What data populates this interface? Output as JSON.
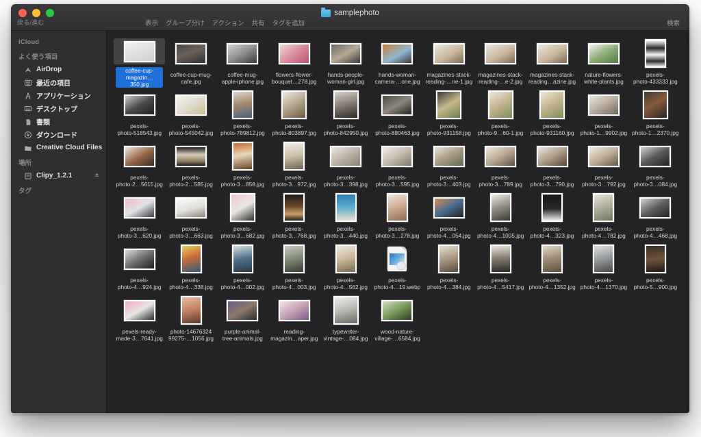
{
  "window": {
    "title": "samplephoto",
    "nav_label": "戻る/進む",
    "folder_icon": "folder-icon",
    "traffic": {
      "close": "close-button",
      "minimize": "minimize-button",
      "maximize": "maximize-button"
    }
  },
  "toolbar": {
    "items": [
      {
        "label": "表示",
        "name": "view"
      },
      {
        "label": "グループ分け",
        "name": "group-by"
      },
      {
        "label": "アクション",
        "name": "action"
      },
      {
        "label": "共有",
        "name": "share"
      },
      {
        "label": "タグを追加",
        "name": "add-tag"
      }
    ],
    "search_label": "検索"
  },
  "sidebar": {
    "sections": [
      {
        "header": "iCloud",
        "items": []
      },
      {
        "header": "よく使う項目",
        "items": [
          {
            "label": "AirDrop",
            "icon": "airdrop-icon"
          },
          {
            "label": "最近の項目",
            "icon": "recents-icon"
          },
          {
            "label": "アプリケーション",
            "icon": "applications-icon"
          },
          {
            "label": "デスクトップ",
            "icon": "desktop-icon"
          },
          {
            "label": "書類",
            "icon": "documents-icon"
          },
          {
            "label": "ダウンロード",
            "icon": "downloads-icon"
          },
          {
            "label": "Creative Cloud Files",
            "icon": "folder-icon"
          }
        ]
      },
      {
        "header": "場所",
        "items": [
          {
            "label": "Clipy_1.2.1",
            "icon": "disk-icon",
            "eject": true
          }
        ]
      },
      {
        "header": "タグ",
        "items": []
      }
    ]
  },
  "colors": {
    "selection_blue": "#1f6fd8",
    "window_bg": "#2a2a2c",
    "content_bg": "#232325",
    "sidebar_bg": "#2f2f31",
    "text": "#d4d4d6"
  },
  "files": [
    {
      "name": "coffee-cup-\nmagazin…350.jpg",
      "type": "image",
      "selected": true,
      "w": 46,
      "h": 31,
      "bg": "linear-gradient(160deg,#f2f2f0 0%,#e3e3e1 40%,#cfcfcd 100%)"
    },
    {
      "name": "coffee-cup-mug-\ncafe.jpg",
      "type": "image",
      "selected": false,
      "w": 46,
      "h": 31,
      "bg": "linear-gradient(160deg,#4a4440 0%,#6b6158 45%,#30312f 100%)"
    },
    {
      "name": "coffee-mug-\napple-iphone.jpg",
      "type": "image",
      "selected": false,
      "w": 46,
      "h": 31,
      "bg": "linear-gradient(150deg,#cfd3d4 0%,#8d8f8c 50%,#3b3a38 100%)"
    },
    {
      "name": "flowers-flower-\nbouquet…278.jpg",
      "type": "image",
      "selected": false,
      "w": 46,
      "h": 31,
      "bg": "linear-gradient(140deg,#f0d9d4 0%,#d98b9a 50%,#b35a72 100%)"
    },
    {
      "name": "hands-people-\nwoman-girl.jpg",
      "type": "image",
      "selected": false,
      "w": 46,
      "h": 31,
      "bg": "linear-gradient(150deg,#6d6a64 0%,#b7a896 50%,#3d3a36 100%)"
    },
    {
      "name": "hands-woman-\ncamera-…one.jpg",
      "type": "image",
      "selected": false,
      "w": 46,
      "h": 31,
      "bg": "linear-gradient(150deg,#c87f3c 0%,#8fb8cf 55%,#3b3b3d 100%)"
    },
    {
      "name": "magazines-stack-\nreading-…ne-1.jpg",
      "type": "image",
      "selected": false,
      "w": 46,
      "h": 31,
      "bg": "linear-gradient(150deg,#e8e7e3 0%,#c9b69b 55%,#7d6b58 100%)"
    },
    {
      "name": "magazines-stack-\nreading-…e-2.jpg",
      "type": "image",
      "selected": false,
      "w": 46,
      "h": 31,
      "bg": "linear-gradient(150deg,#e8e7e3 0%,#c9b69b 55%,#7d6b58 100%)"
    },
    {
      "name": "magazines-stack-\nreading…azine.jpg",
      "type": "image",
      "selected": false,
      "w": 46,
      "h": 31,
      "bg": "linear-gradient(150deg,#e8e7e3 0%,#c9b69b 55%,#7d6b58 100%)"
    },
    {
      "name": "nature-flowers-\nwhite-plants.jpg",
      "type": "image",
      "selected": false,
      "w": 46,
      "h": 31,
      "bg": "linear-gradient(150deg,#eef1ec 0%,#8fae78 50%,#4f7a46 100%)"
    },
    {
      "name": "pexels-\nphoto-433333.jpg",
      "type": "image",
      "selected": false,
      "w": 31,
      "h": 42,
      "bg": "linear-gradient(180deg,#ffffff 0%,#2b2b2b 30%,#f2f2f2 55%,#303030 80%,#e9e9e9 100%)"
    },
    {
      "name": "pexels-\nphoto-518543.jpg",
      "type": "image",
      "selected": false,
      "w": 46,
      "h": 31,
      "bg": "linear-gradient(150deg,#c9cdd0 0%,#4a4b4d 50%,#1d1e20 100%)"
    },
    {
      "name": "pexels-\nphoto-545042.jpg",
      "type": "image",
      "selected": false,
      "w": 46,
      "h": 31,
      "bg": "linear-gradient(150deg,#f4f3ef 0%,#ded9c8 55%,#c8b98f 100%)"
    },
    {
      "name": "pexels-\nphoto-789812.jpg",
      "type": "image",
      "selected": false,
      "w": 31,
      "h": 42,
      "bg": "linear-gradient(170deg,#d9d5cb 0%,#a88b6e 45%,#49617e 100%)"
    },
    {
      "name": "pexels-\nphoto-803897.jpg",
      "type": "image",
      "selected": false,
      "w": 37,
      "h": 42,
      "bg": "linear-gradient(150deg,#efece4 0%,#b4a58c 50%,#6d5a43 100%)"
    },
    {
      "name": "pexels-\nphoto-842950.jpg",
      "type": "image",
      "selected": false,
      "w": 37,
      "h": 42,
      "bg": "linear-gradient(165deg,#d8d4cb 0%,#7a7168 55%,#2e2b27 100%)"
    },
    {
      "name": "pexels-\nphoto-880463.jpg",
      "type": "image",
      "selected": false,
      "w": 46,
      "h": 31,
      "bg": "linear-gradient(150deg,#4d4a45 0%,#8c867c 50%,#24221f 100%)"
    },
    {
      "name": "pexels-\nphoto-931158.jpg",
      "type": "image",
      "selected": false,
      "w": 37,
      "h": 42,
      "bg": "linear-gradient(150deg,#3a3a38 0%,#c7b88f 50%,#6b7d4a 100%)"
    },
    {
      "name": "pexels-\nphoto-9…60-1.jpg",
      "type": "image",
      "selected": false,
      "w": 37,
      "h": 42,
      "bg": "linear-gradient(150deg,#efe8da 0%,#c3b28d 50%,#7f8d5a 100%)"
    },
    {
      "name": "pexels-\nphoto-931160.jpg",
      "type": "image",
      "selected": false,
      "w": 37,
      "h": 42,
      "bg": "linear-gradient(150deg,#efe8da 0%,#c3b28d 50%,#7f8d5a 100%)"
    },
    {
      "name": "pexels-\nphoto-1…9902.jpg",
      "type": "image",
      "selected": false,
      "w": 46,
      "h": 31,
      "bg": "linear-gradient(150deg,#e7e3dc 0%,#b9ada0 50%,#6d6659 100%)"
    },
    {
      "name": "pexels-\nphoto-1…2370.jpg",
      "type": "image",
      "selected": false,
      "w": 37,
      "h": 42,
      "bg": "linear-gradient(150deg,#3e3a36 0%,#8a5a3c 45%,#2a2724 100%)"
    },
    {
      "name": "pexels-\nphoto-2…5615.jpg",
      "type": "image",
      "selected": false,
      "w": 46,
      "h": 31,
      "bg": "linear-gradient(150deg,#efe7dc 0%,#9a6a4a 50%,#3a2b22 100%)"
    },
    {
      "name": "pexels-\nphoto-2…585.jpg",
      "type": "image",
      "selected": false,
      "w": 46,
      "h": 31,
      "bg": "linear-gradient(180deg,#1d1d1d 0%,#d8cdbb 40%,#8f7e63 75%,#1d1d1d 100%)"
    },
    {
      "name": "pexels-\nphoto-3…858.jpg",
      "type": "image",
      "selected": false,
      "w": 31,
      "h": 42,
      "bg": "linear-gradient(170deg,#c96a2a 0%,#e8d7bb 45%,#6a4424 100%)"
    },
    {
      "name": "pexels-\nphoto-3…972.jpg",
      "type": "image",
      "selected": false,
      "w": 31,
      "h": 42,
      "bg": "linear-gradient(170deg,#f0ece6 0%,#cbbda8 50%,#6f6253 100%)"
    },
    {
      "name": "pexels-\nphoto-3…398.jpg",
      "type": "image",
      "selected": false,
      "w": 46,
      "h": 31,
      "bg": "linear-gradient(150deg,#eae6df 0%,#bdb3a5 50%,#8a8075 100%)"
    },
    {
      "name": "pexels-\nphoto-3…595.jpg",
      "type": "image",
      "selected": false,
      "w": 46,
      "h": 31,
      "bg": "linear-gradient(150deg,#efece7 0%,#c5bbae 50%,#7e766b 100%)"
    },
    {
      "name": "pexels-\nphoto-3…403.jpg",
      "type": "image",
      "selected": false,
      "w": 46,
      "h": 31,
      "bg": "linear-gradient(150deg,#e8e4da 0%,#a89a82 50%,#5d6b4d 100%)"
    },
    {
      "name": "pexels-\nphoto-3…789.jpg",
      "type": "image",
      "selected": false,
      "w": 46,
      "h": 31,
      "bg": "linear-gradient(150deg,#efe9e0 0%,#b9a894 50%,#5f5247 100%)"
    },
    {
      "name": "pexels-\nphoto-3…790.jpg",
      "type": "image",
      "selected": false,
      "w": 46,
      "h": 31,
      "bg": "linear-gradient(150deg,#ece7de 0%,#ad9c87 50%,#56493e 100%)"
    },
    {
      "name": "pexels-\nphoto-3…792.jpg",
      "type": "image",
      "selected": false,
      "w": 46,
      "h": 31,
      "bg": "linear-gradient(150deg,#f0ebe2 0%,#bfae98 50%,#665a4d 100%)"
    },
    {
      "name": "pexels-\nphoto-3…084.jpg",
      "type": "image",
      "selected": false,
      "w": 46,
      "h": 31,
      "bg": "linear-gradient(150deg,#cfd3d6 0%,#59585a 50%,#242426 100%)"
    },
    {
      "name": "pexels-\nphoto-3…620.jpg",
      "type": "image",
      "selected": false,
      "w": 46,
      "h": 31,
      "bg": "linear-gradient(150deg,#f2b9c9 0%,#dfe3e6 50%,#3b3b3d 100%)"
    },
    {
      "name": "pexels-\nphoto-3…663.jpg",
      "type": "image",
      "selected": false,
      "w": 46,
      "h": 31,
      "bg": "linear-gradient(165deg,#fbfbfa 0%,#e0ded9 55%,#8d857b 100%)"
    },
    {
      "name": "pexels-\nphoto-3…682.jpg",
      "type": "image",
      "selected": false,
      "w": 37,
      "h": 42,
      "bg": "linear-gradient(150deg,#f0c7d6 0%,#e9e6e1 50%,#2e2e30 100%)"
    },
    {
      "name": "pexels-\nphoto-3…768.jpg",
      "type": "image",
      "selected": false,
      "w": 31,
      "h": 42,
      "bg": "linear-gradient(180deg,#1e1a17 0%,#6b4a2c 45%,#caa06a 75%,#231d18 100%)"
    },
    {
      "name": "pexels-\nphoto-3…440.jpg",
      "type": "image",
      "selected": false,
      "w": 31,
      "h": 42,
      "bg": "linear-gradient(180deg,#2f7fae 0%,#58a9cf 45%,#e8dfcd 100%)"
    },
    {
      "name": "pexels-\nphoto-3…278.jpg",
      "type": "image",
      "selected": false,
      "w": 31,
      "h": 42,
      "bg": "linear-gradient(160deg,#efe6dd 0%,#cfa98d 50%,#8a6a53 100%)"
    },
    {
      "name": "pexels-\nphoto-4…054.jpg",
      "type": "image",
      "selected": false,
      "w": 46,
      "h": 31,
      "bg": "linear-gradient(150deg,#d98b55 0%,#4a6e8f 50%,#1f1f21 100%)"
    },
    {
      "name": "pexels-\nphoto-4…1005.jpg",
      "type": "image",
      "selected": false,
      "w": 31,
      "h": 42,
      "bg": "linear-gradient(160deg,#efece6 0%,#8f8a82 50%,#3b3935 100%)"
    },
    {
      "name": "pexels-\nphoto-4…323.jpg",
      "type": "image",
      "selected": false,
      "w": 31,
      "h": 42,
      "bg": "linear-gradient(180deg,#161616 0%,#2a2a2a 55%,#efefef 100%)"
    },
    {
      "name": "pexels-\nphoto-4…782.jpg",
      "type": "image",
      "selected": false,
      "w": 31,
      "h": 42,
      "bg": "linear-gradient(160deg,#eae6de 0%,#b6b09f 45%,#6d7a58 100%)"
    },
    {
      "name": "pexels-\nphoto-4…468.jpg",
      "type": "image",
      "selected": false,
      "w": 46,
      "h": 31,
      "bg": "linear-gradient(150deg,#cfd2d4 0%,#5f5e60 50%,#232325 100%)"
    },
    {
      "name": "pexels-\nphoto-4…924.jpg",
      "type": "image",
      "selected": false,
      "w": 46,
      "h": 31,
      "bg": "linear-gradient(150deg,#dcdcda 0%,#6f6e6c 50%,#1f1f1f 100%)"
    },
    {
      "name": "pexels-\nphoto-4…338.jpg",
      "type": "image",
      "selected": false,
      "w": 31,
      "h": 42,
      "bg": "linear-gradient(160deg,#e8d35a 0%,#c86b3a 45%,#2f5a7a 100%)"
    },
    {
      "name": "pexels-\nphoto-4…002.jpg",
      "type": "image",
      "selected": false,
      "w": 31,
      "h": 42,
      "bg": "linear-gradient(170deg,#d9dde0 0%,#4f6f8c 50%,#2a3a46 100%)"
    },
    {
      "name": "pexels-\nphoto-4…003.jpg",
      "type": "image",
      "selected": false,
      "w": 31,
      "h": 42,
      "bg": "linear-gradient(165deg,#cfcabf 0%,#7d8a73 50%,#3a3a38 100%)"
    },
    {
      "name": "pexels-\nphoto-4…562.jpg",
      "type": "image",
      "selected": false,
      "w": 31,
      "h": 42,
      "bg": "linear-gradient(165deg,#efe9df 0%,#c8b79a 50%,#7a6a52 100%)"
    },
    {
      "name": "pexels-\nphoto-4…19.webp",
      "type": "doc",
      "selected": false,
      "w": 28,
      "h": 36,
      "bg": ""
    },
    {
      "name": "pexels-\nphoto-4…384.jpg",
      "type": "image",
      "selected": false,
      "w": 31,
      "h": 42,
      "bg": "linear-gradient(165deg,#e6ded2 0%,#a8957e 50%,#5a4e41 100%)"
    },
    {
      "name": "pexels-\nphoto-4…5417.jpg",
      "type": "image",
      "selected": false,
      "w": 31,
      "h": 42,
      "bg": "linear-gradient(175deg,#e9e4da 0%,#8a8274 45%,#2a2724 100%)"
    },
    {
      "name": "pexels-\nphoto-4…1352.jpg",
      "type": "image",
      "selected": false,
      "w": 31,
      "h": 42,
      "bg": "linear-gradient(165deg,#ded7cb 0%,#9d8a71 50%,#5d4f3f 100%)"
    },
    {
      "name": "pexels-\nphoto-4…1370.jpg",
      "type": "image",
      "selected": false,
      "w": 31,
      "h": 42,
      "bg": "linear-gradient(165deg,#dfe0dc 0%,#9aa0a2 45%,#4a4a48 100%)"
    },
    {
      "name": "pexels-\nphoto-5…900.jpg",
      "type": "image",
      "selected": false,
      "w": 31,
      "h": 42,
      "bg": "linear-gradient(175deg,#3a2e22 0%,#6b543c 50%,#221a12 100%)"
    },
    {
      "name": "pexels-ready-\nmade-3…7641.jpg",
      "type": "image",
      "selected": false,
      "w": 46,
      "h": 31,
      "bg": "linear-gradient(150deg,#f3a9c2 0%,#e8e6e2 50%,#2e2e30 100%)"
    },
    {
      "name": "photo-14676324\n99275-…1056.jpg",
      "type": "image",
      "selected": false,
      "w": 31,
      "h": 42,
      "bg": "linear-gradient(165deg,#e8bfa0 0%,#c07f5e 50%,#5a3a2a 100%)"
    },
    {
      "name": "purple-animal-\ntree-animals.jpg",
      "type": "image",
      "selected": false,
      "w": 46,
      "h": 31,
      "bg": "linear-gradient(150deg,#6a5a8a 0%,#8a7a6a 50%,#2a2a30 100%)"
    },
    {
      "name": "reading-\nmagazin…aper.jpg",
      "type": "image",
      "selected": false,
      "w": 46,
      "h": 31,
      "bg": "linear-gradient(150deg,#efe3e8 0%,#c8a0b4 50%,#7a5a88 100%)"
    },
    {
      "name": "typewriter-\nvintage-…084.jpg",
      "type": "image",
      "selected": false,
      "w": 37,
      "h": 42,
      "bg": "linear-gradient(165deg,#efefed 0%,#b8b6b0 50%,#6a6862 100%)"
    },
    {
      "name": "wood-nature-\nvillage-…6584.jpg",
      "type": "image",
      "selected": false,
      "w": 46,
      "h": 31,
      "bg": "linear-gradient(150deg,#cfe0c0 0%,#7a9a5a 50%,#2e3a24 100%)"
    }
  ]
}
